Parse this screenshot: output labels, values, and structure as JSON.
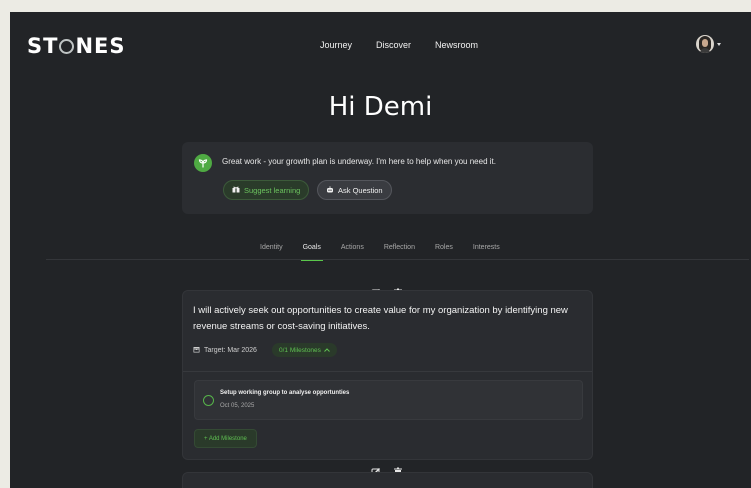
{
  "header": {
    "logo_prefix": "ST",
    "logo_suffix": "NES",
    "nav": [
      "Journey",
      "Discover",
      "Newsroom"
    ],
    "icons": [
      "avatar",
      "chevron-down-icon"
    ]
  },
  "greeting": "Hi Demi",
  "assistant_card": {
    "message": "Great work - your growth plan is underway. I'm here to help when you need it.",
    "suggest_label": "Suggest learning",
    "ask_label": "Ask Question",
    "icons": [
      "sprout-icon",
      "gift-icon",
      "robot-icon"
    ]
  },
  "tabs": {
    "items": [
      "Identity",
      "Goals",
      "Actions",
      "Reflection",
      "Roles",
      "Interests"
    ],
    "active": "Goals"
  },
  "goals": [
    {
      "text": "I will actively seek out opportunities to create value for my organization by identifying new revenue streams or cost-saving initiatives.",
      "target": "Target: Mar 2026",
      "milestones_label": "0/1 Milestones",
      "milestone": {
        "title": "Setup working group to analyse opportunties",
        "date": "Oct 05, 2025"
      },
      "add_milestone_label": "+ Add Milestone"
    }
  ],
  "colors": {
    "accent": "#5ac74b",
    "background": "#222427",
    "card": "#2b2d31"
  }
}
